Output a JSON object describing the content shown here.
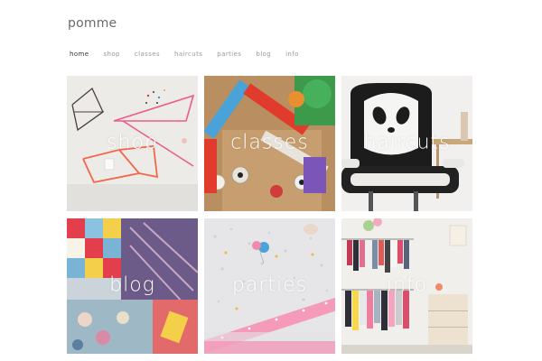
{
  "site": {
    "logo": "pomme"
  },
  "nav": {
    "items": [
      {
        "label": "home",
        "active": true
      },
      {
        "label": "shop",
        "active": false
      },
      {
        "label": "classes",
        "active": false
      },
      {
        "label": "haircuts",
        "active": false
      },
      {
        "label": "parties",
        "active": false
      },
      {
        "label": "blog",
        "active": false
      },
      {
        "label": "info",
        "active": false
      }
    ]
  },
  "tiles": [
    {
      "label": "shop"
    },
    {
      "label": "classes"
    },
    {
      "label": "haircuts"
    },
    {
      "label": "blog"
    },
    {
      "label": "parties"
    },
    {
      "label": "info"
    }
  ]
}
